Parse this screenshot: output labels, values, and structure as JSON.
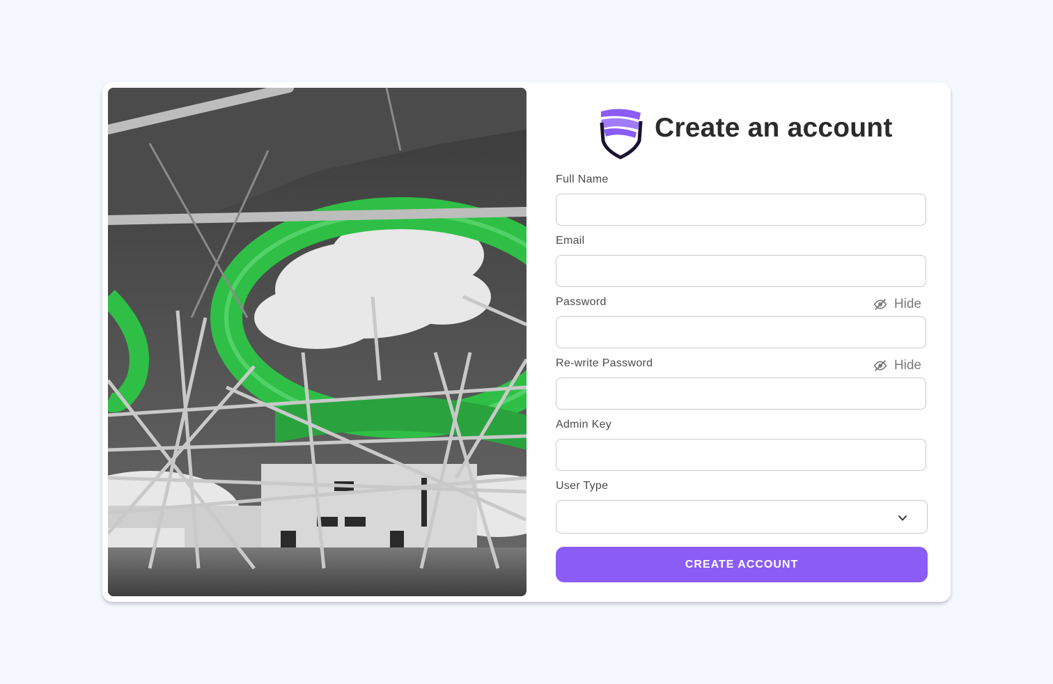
{
  "page": {
    "title": "Create an account",
    "brand_color": "#8b5cf6",
    "background": "#f5f9ff"
  },
  "hero_image": {
    "description_icon": "photo-water-slide-structure",
    "accent_color": "#35c64a"
  },
  "logo": {
    "icon": "shield-icon",
    "colors": [
      "#8b5cf6",
      "#1a1330"
    ]
  },
  "form": {
    "fields": [
      {
        "label": "Full Name",
        "value": "",
        "placeholder": ""
      },
      {
        "label": "Email",
        "value": "",
        "placeholder": ""
      },
      {
        "label": "Password",
        "value": "",
        "placeholder": "",
        "toggle_label": "Hide",
        "toggle_icon": "eye-slash-icon"
      },
      {
        "label": "Re-write Password",
        "value": "",
        "placeholder": "",
        "toggle_label": "Hide",
        "toggle_icon": "eye-slash-icon"
      },
      {
        "label": "Admin Key",
        "value": "",
        "placeholder": ""
      }
    ],
    "user_type": {
      "label": "User Type",
      "value": "",
      "icon": "chevron-down-icon"
    },
    "submit_label": "CREATE ACCOUNT"
  }
}
